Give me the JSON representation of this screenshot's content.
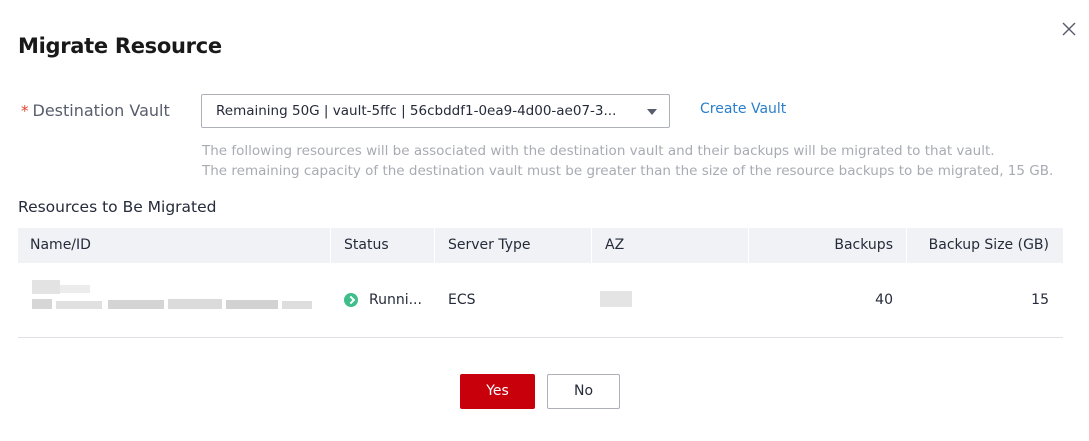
{
  "dialog": {
    "title": "Migrate Resource",
    "close_icon": "close-icon"
  },
  "destination": {
    "required_mark": "*",
    "label": "Destination Vault",
    "selected_value": "Remaining 50G | vault-5ffc | 56cbddf1-0ea9-4d00-ae07-3...",
    "create_link": "Create Vault",
    "hint_line1": "The following resources will be associated with the destination vault and their backups will be migrated to that vault.",
    "hint_line2": "The remaining capacity of the destination vault must be greater than the size of the resource backups to be migrated, 15 GB."
  },
  "resources": {
    "section_title": "Resources to Be Migrated",
    "columns": [
      "Name/ID",
      "Status",
      "Server Type",
      "AZ",
      "Backups",
      "Backup Size (GB)"
    ],
    "rows": [
      {
        "status": "Runni...",
        "status_color": "#3fbd8b",
        "server_type": "ECS",
        "backups": "40",
        "backup_size": "15"
      }
    ]
  },
  "actions": {
    "yes_label": "Yes",
    "no_label": "No",
    "yes_color": "#c7000b"
  }
}
